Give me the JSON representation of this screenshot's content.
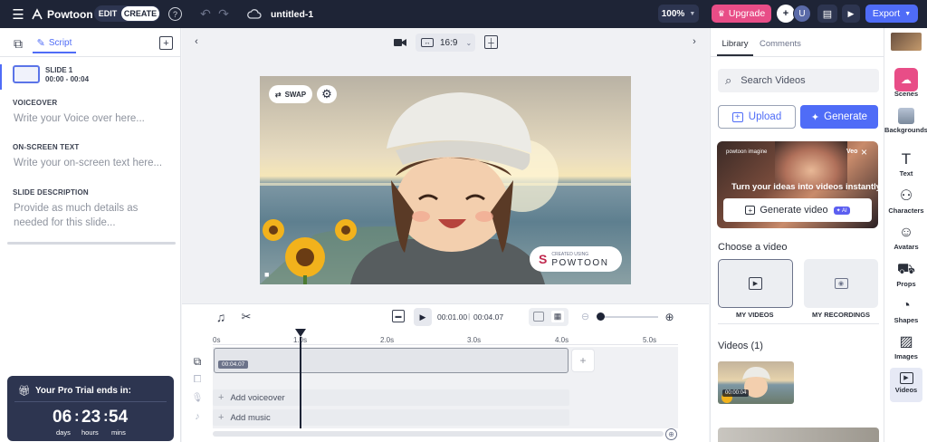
{
  "topbar": {
    "logo_text": "Powtoon",
    "edit_label": "EDIT",
    "create_label": "CREATE",
    "file_name": "untitled-1",
    "zoom": "100%",
    "upgrade_label": "Upgrade",
    "avatar_letter": "U",
    "export_label": "Export"
  },
  "left": {
    "script_tab": "Script",
    "slide_title": "SLIDE 1",
    "slide_time": "00:00 - 00:04",
    "voiceover_label": "VOICEOVER",
    "voiceover_placeholder": "Write your Voice over here...",
    "onscreen_label": "ON-SCREEN TEXT",
    "onscreen_placeholder": "Write your on-screen text here...",
    "description_label": "SLIDE DESCRIPTION",
    "description_placeholder": "Provide as much details as needed for this slide...",
    "trial_title": "Your Pro Trial ends in:",
    "days_value": "06",
    "days_label": "days",
    "hours_value": "23",
    "hours_label": "hours",
    "mins_value": "54",
    "mins_label": "mins"
  },
  "canvas": {
    "aspect": "16:9",
    "swap_label": "SWAP",
    "watermark_small": "CREATED USING",
    "watermark_brand": "POWTOON"
  },
  "timeline": {
    "current_time": "00:01.00",
    "separator": "|",
    "total_time": "00:04.07",
    "ticks": [
      "0s",
      "1.0s",
      "2.0s",
      "3.0s",
      "4.0s",
      "5.0s"
    ],
    "clip_label": "00:04.07",
    "add_voiceover": "Add voiceover",
    "add_music": "Add music"
  },
  "right": {
    "tab_library": "Library",
    "tab_comments": "Comments",
    "search_placeholder": "Search Videos",
    "upload_label": "Upload",
    "generate_label": "Generate",
    "promo_brand": "powtoon imagine",
    "promo_badge": "Veo",
    "promo_text": "Turn your ideas into videos instantly",
    "promo_button": "Generate video",
    "promo_ai": "AI",
    "choose_title": "Choose a video",
    "my_videos": "MY VIDEOS",
    "my_recordings": "MY RECORDINGS",
    "videos_count_title": "Videos (1)",
    "thumb_duration": "00:00:04"
  },
  "rail": {
    "items": [
      "Scenes",
      "Backgrounds",
      "Text",
      "Characters",
      "Avatars",
      "Props",
      "Shapes",
      "Images",
      "Videos"
    ]
  },
  "colors": {
    "topbar": "#1e2436",
    "upgrade": "#e84d87",
    "export": "#4f6cf7",
    "accent": "#4f6cf7",
    "trial": "#2d3550"
  }
}
